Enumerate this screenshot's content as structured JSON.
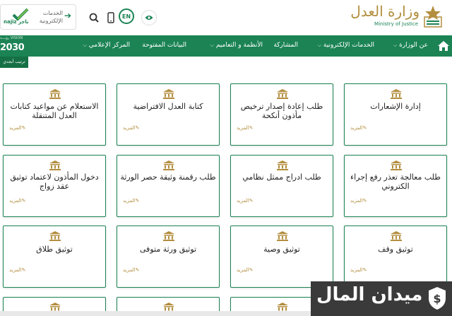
{
  "header": {
    "ministry_ar": "وزارة العدل",
    "ministry_en": "Ministry of Justice",
    "lang_badge": "EN",
    "najiz_label": "الخدمات الإلكترونية",
    "najiz_logo": "najiz ناجز"
  },
  "nav": {
    "items": [
      {
        "label": "عن الوزارة",
        "dropdown": true
      },
      {
        "label": "الخدمات الإلكترونية",
        "dropdown": true
      },
      {
        "label": "المشاركة",
        "dropdown": false
      },
      {
        "label": "الأنظمة و التعاميم",
        "dropdown": true
      },
      {
        "label": "البيانات المفتوحة",
        "dropdown": false
      },
      {
        "label": "المركز الإعلامي",
        "dropdown": true
      }
    ],
    "vision_small": "رؤيـــة VISION",
    "vision_year": "2030",
    "sort_label": "ترتيب أبجدي"
  },
  "more_label": "المزيد",
  "cards": [
    {
      "title": "إدارة الإشعارات"
    },
    {
      "title": "طلب إعادة إصدار ترخيص مأذون أنكحة"
    },
    {
      "title": "كتابة العدل الافتراضية"
    },
    {
      "title": "الاستعلام عن مواعيد كتابات العدل المتنقلة"
    },
    {
      "title": "طلب معالجة تعذر رفع إجراء الكتروني"
    },
    {
      "title": "طلب ادراج ممثل نظامي"
    },
    {
      "title": "طلب رقمنة وثيقة حصر الورثة"
    },
    {
      "title": "دخول المأذون لاعتماد توثيق عقد زواج"
    },
    {
      "title": "توثيق وقف"
    },
    {
      "title": "توثيق وصية"
    },
    {
      "title": "توثيق ورثة متوفى"
    },
    {
      "title": "توثيق طلاق"
    }
  ],
  "watermark": {
    "text": "ميدان المال"
  },
  "colors": {
    "primary": "#1b8354",
    "gold": "#b38e3f"
  }
}
